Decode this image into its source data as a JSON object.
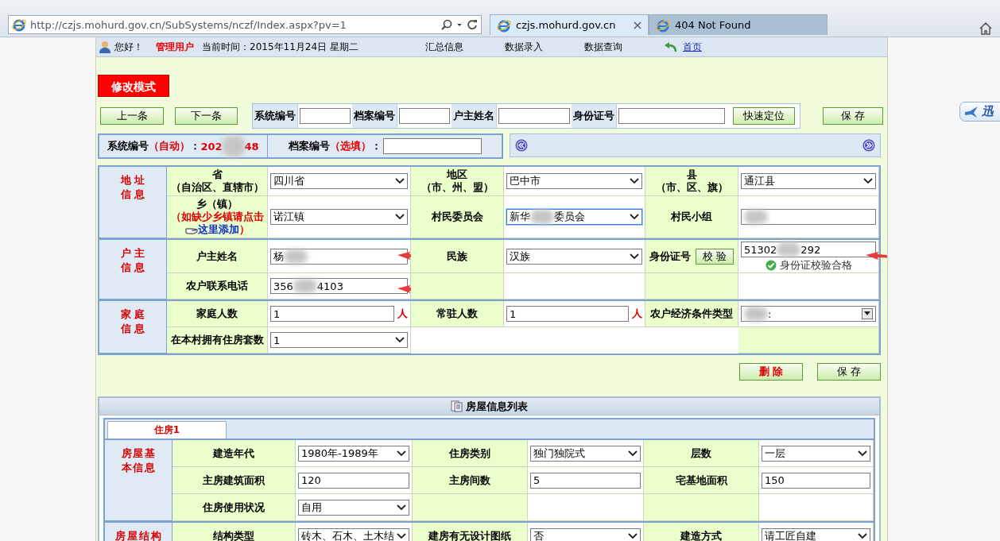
{
  "browser": {
    "url": "http://czjs.mohurd.gov.cn/SubSystems/nczf/Index.aspx?pv=1",
    "tabs": [
      {
        "title": "czjs.mohurd.gov.cn",
        "selected": true
      },
      {
        "title": "404 Not Found",
        "selected": false
      }
    ]
  },
  "nav": {
    "greeting": "您好！",
    "user": "管理用户",
    "time": "当前时间：2015年11月24日 星期二",
    "links": [
      "汇总信息",
      "数据录入",
      "数据查询"
    ],
    "home": "首页"
  },
  "mode_badge": "修改模式",
  "toolbar": {
    "prev": "上一条",
    "next": "下一条",
    "search_fields": [
      {
        "label": "系统编号"
      },
      {
        "label": "档案编号"
      },
      {
        "label": "户主姓名"
      },
      {
        "label": "身份证号"
      }
    ],
    "locate": "快速定位",
    "save": "保 存"
  },
  "header": {
    "system_no": {
      "label": "系统编号",
      "tag": "（自动）",
      "sep": "：",
      "parts": [
        "202",
        "48"
      ]
    },
    "archive_no": {
      "label": "档案编号",
      "tag": "（选填）",
      "sep": "："
    }
  },
  "sections": [
    {
      "title": "地址信息",
      "rows": [
        [
          {
            "kind": "label",
            "text": "省",
            "sub": "（自治区、直辖市）"
          },
          {
            "kind": "select",
            "value": "四川省"
          },
          {
            "kind": "label",
            "text": "地区",
            "sub": "（市、州、盟）"
          },
          {
            "kind": "select",
            "value": "巴中市"
          },
          {
            "kind": "label",
            "text": "县",
            "sub": "（市、区、旗）"
          },
          {
            "kind": "select",
            "value": "通江县"
          }
        ],
        [
          {
            "kind": "label",
            "text": "乡（镇）",
            "note": "（如缺少乡镇请点击",
            "link": "这里添加",
            "note_end": "）"
          },
          {
            "kind": "select",
            "value": "诺江镇"
          },
          {
            "kind": "label",
            "text": "村民委员会"
          },
          {
            "kind": "select",
            "parts": [
              "新华",
              "委员会"
            ],
            "focused": true
          },
          {
            "kind": "label",
            "text": "村民小组"
          },
          {
            "kind": "input",
            "blurred": true
          }
        ]
      ]
    },
    {
      "title": "户主信息",
      "rows": [
        [
          {
            "kind": "label",
            "text": "户主姓名"
          },
          {
            "kind": "input",
            "parts": [
              "杨"
            ],
            "arrow": true
          },
          {
            "kind": "label",
            "text": "民族"
          },
          {
            "kind": "select",
            "value": "汉族"
          },
          {
            "kind": "label",
            "text": "身份证号",
            "button": "校 验"
          },
          {
            "kind": "input",
            "parts": [
              "51302",
              "292"
            ],
            "arrow": true,
            "check": "身份证校验合格"
          }
        ],
        [
          {
            "kind": "label",
            "text": "农户联系电话"
          },
          {
            "kind": "input",
            "parts": [
              "356",
              "4103"
            ],
            "arrow": true
          },
          {
            "kind": "blank-label"
          },
          {
            "kind": "blank-field"
          },
          {
            "kind": "blank-label"
          },
          {
            "kind": "blank-field"
          }
        ]
      ]
    },
    {
      "title": "家庭信息",
      "rows": [
        [
          {
            "kind": "label",
            "text": "家庭人数"
          },
          {
            "kind": "input",
            "value": "1",
            "unit": "人"
          },
          {
            "kind": "label",
            "text": "常驻人数"
          },
          {
            "kind": "input",
            "value": "1",
            "unit": "人"
          },
          {
            "kind": "label",
            "text": "农户经济条件类型"
          },
          {
            "kind": "combo",
            "value": ":",
            "blurred": true
          }
        ],
        [
          {
            "kind": "label",
            "text": "在本村拥有住房套数"
          },
          {
            "kind": "select",
            "value": "1"
          },
          {
            "kind": "filler"
          }
        ]
      ]
    }
  ],
  "actions": {
    "delete": "删 除",
    "save": "保 存"
  },
  "house": {
    "title": "房屋信息列表",
    "tabs": [
      {
        "label": "住房1",
        "selected": true
      }
    ],
    "sections": [
      {
        "title": "房屋基本信息",
        "rows": [
          [
            {
              "kind": "label",
              "text": "建造年代"
            },
            {
              "kind": "select",
              "value": "1980年-1989年"
            },
            {
              "kind": "label",
              "text": "住房类别"
            },
            {
              "kind": "select",
              "value": "独门独院式"
            },
            {
              "kind": "label",
              "text": "层数"
            },
            {
              "kind": "select",
              "value": "一层"
            }
          ],
          [
            {
              "kind": "label",
              "text": "主房建筑面积"
            },
            {
              "kind": "input",
              "value": "120"
            },
            {
              "kind": "label",
              "text": "主房间数"
            },
            {
              "kind": "input",
              "value": "5"
            },
            {
              "kind": "label",
              "text": "宅基地面积"
            },
            {
              "kind": "input",
              "value": "150"
            }
          ],
          [
            {
              "kind": "label",
              "text": "住房使用状况"
            },
            {
              "kind": "select",
              "value": "自用"
            },
            {
              "kind": "blank-label"
            },
            {
              "kind": "blank-field"
            },
            {
              "kind": "blank-label"
            },
            {
              "kind": "blank-field"
            }
          ]
        ]
      },
      {
        "title": "房屋结构",
        "rows": [
          [
            {
              "kind": "label",
              "text": "结构类型"
            },
            {
              "kind": "select",
              "value": "砖木、石木、土木结"
            },
            {
              "kind": "label",
              "text": "建房有无设计图纸"
            },
            {
              "kind": "select",
              "value": "否"
            },
            {
              "kind": "label",
              "text": "建造方式"
            },
            {
              "kind": "select",
              "value": "请工匠自建"
            }
          ]
        ]
      }
    ]
  },
  "side_tool": {
    "label": "迅"
  }
}
